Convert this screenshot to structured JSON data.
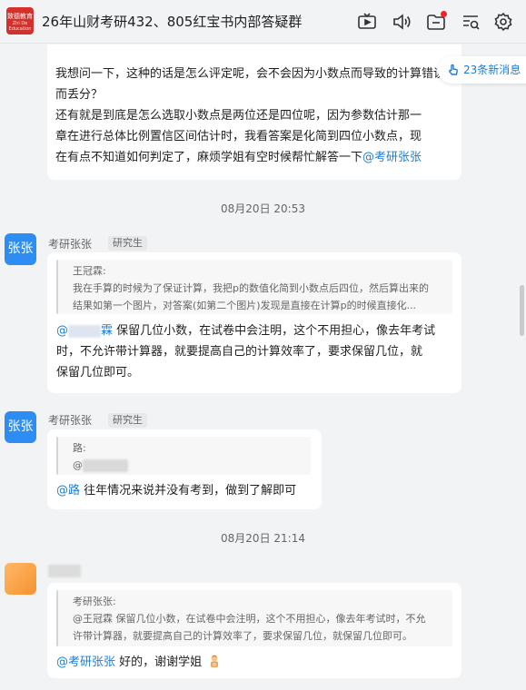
{
  "header": {
    "title": "26年山财考研432、805红宝书内部答疑群",
    "logo_text": "致德教育",
    "logo_subtext": "Zhi De Education",
    "icons": [
      "tv-icon",
      "speaker-icon",
      "folder-icon",
      "search-list-icon",
      "settings-icon"
    ]
  },
  "new_messages": {
    "label": "23条新消息"
  },
  "messages": [
    {
      "lines": [
        "我想问一下，这种的话是怎么评定呢，会不会因为小数点而导致的计算错误",
        "而丢分？",
        "还有就是到底是怎么选取小数点是两位还是四位呢，因为参数估计那一",
        "章在进行总体比例置信区间估计时，我看答案是化简到四位小数点，现",
        "在有点不知道如何判定了，麻烦学姐有空时候帮忙解答一下"
      ],
      "mention": "@考研张张"
    },
    {
      "time": "08月20日 20:53",
      "sender": "考研张张",
      "role": "研究生",
      "avatar_text": "张张",
      "quote": {
        "author": "王冠霖:",
        "lines": [
          "我在手算的时候为了保证计算，我把p的数值化简到小数点后四位，然后算出来的",
          "结果如第一个图片，对答案(如第二个图片)发现是直接在计算p的时候直接化..."
        ]
      },
      "mention": "@",
      "mention_tail": "霖",
      "lines": [
        "保留几位小数，在试卷中会注明，这个不用担心，像去年考试",
        "时，不允许带计算器，就要提高自己的计算效率了，要求保留几位，就",
        "保留几位即可。"
      ]
    },
    {
      "sender": "考研张张",
      "role": "研究生",
      "avatar_text": "张张",
      "quote": {
        "author": "路:",
        "line": "@"
      },
      "mention": "@路",
      "text": "往年情况来说并没有考到，做到了解即可"
    },
    {
      "time": "08月20日 21:14",
      "quote": {
        "author": "考研张张:",
        "lines": [
          "@王冠霖 保留几位小数，在试卷中会注明，这个不用担心，像去年考试时，不允",
          "许带计算器，就要提高自己的计算效率了，要求保留几位，就保留几位即可。"
        ]
      },
      "mention": "@考研张张",
      "text": "好的，谢谢学姐"
    }
  ],
  "colors": {
    "accent": "#1c7ed6",
    "avatar_blue": "#2e8df3",
    "logo_red": "#d72f2a",
    "bg": "#f2f3f5"
  }
}
